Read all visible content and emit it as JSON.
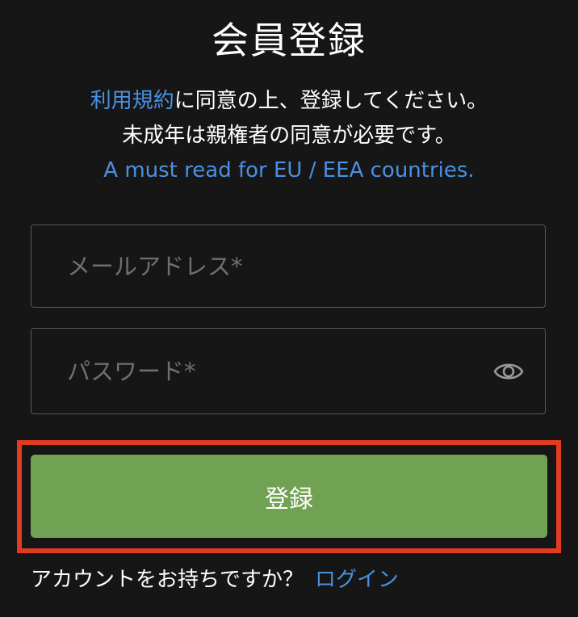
{
  "title": "会員登録",
  "intro": {
    "terms_link": "利用規約",
    "line1_rest": "に同意の上、登録してください。",
    "line2": "未成年は親権者の同意が必要です。",
    "eu_link": "A must read for EU / EEA countries."
  },
  "form": {
    "email_placeholder": "メールアドレス*",
    "password_placeholder": "パスワード*",
    "show_password_icon": "eye-icon",
    "submit_label": "登録"
  },
  "footer": {
    "prompt": "アカウントをお持ちですか？",
    "login_link": "ログイン"
  },
  "colors": {
    "background": "#161616",
    "link": "#4a90e2",
    "button": "#71a152",
    "highlight": "#e23b22",
    "field_border": "#5a5a5a",
    "placeholder": "#6f6f6f"
  }
}
